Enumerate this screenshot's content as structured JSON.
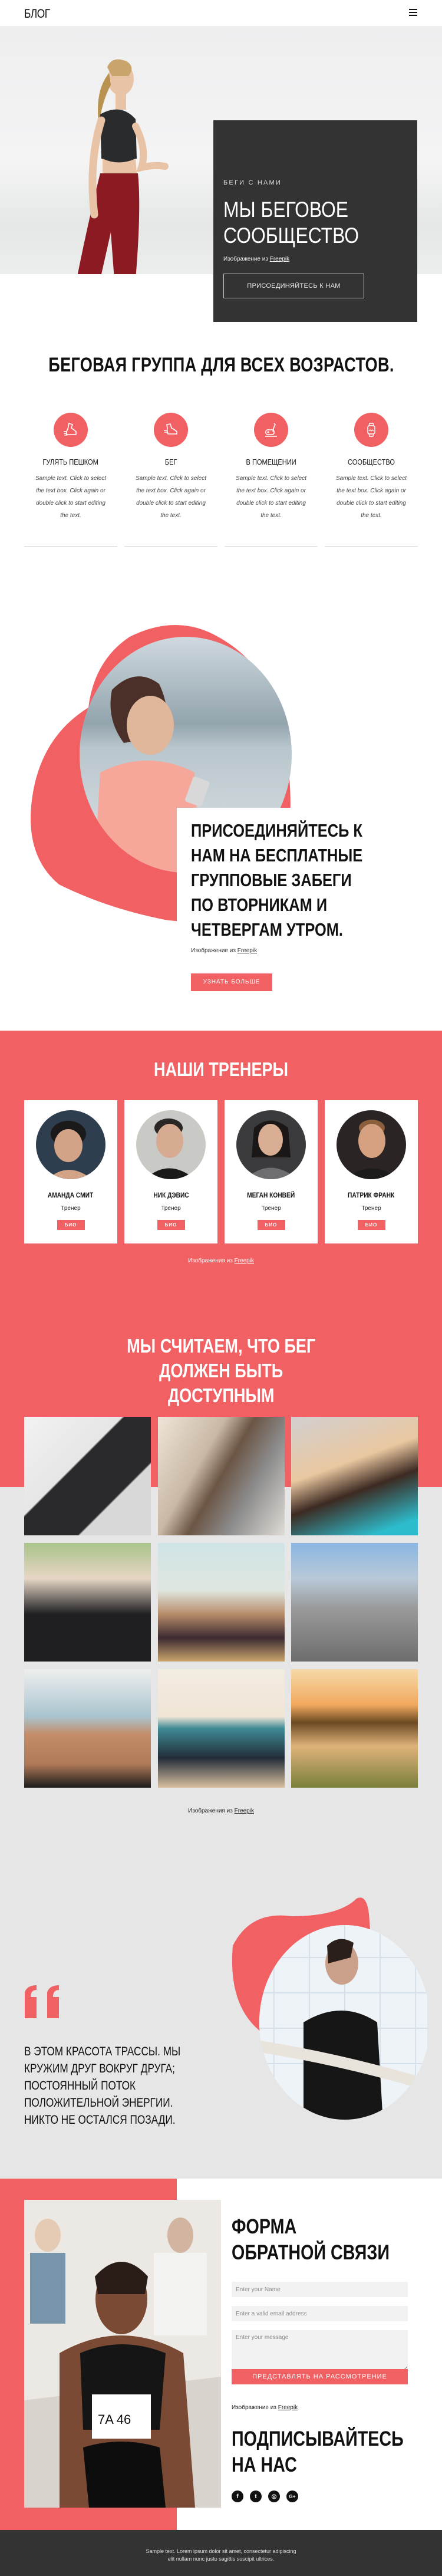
{
  "header": {
    "logo": "БЛОГ",
    "menu_icon": "hamburger-icon"
  },
  "hero": {
    "kicker": "БЕГИ С НАМИ",
    "title_line1": "МЫ БЕГОВОЕ",
    "title_line2": "СООБЩЕСТВО",
    "credit_prefix": "Изображение из",
    "credit_link": "Freepik",
    "button": "ПРИСОЕДИНЯЙТЕСЬ К НАМ"
  },
  "features": {
    "title": "БЕГОВАЯ ГРУППА ДЛЯ ВСЕХ ВОЗРАСТОВ.",
    "items": [
      {
        "icon": "walking-shoe-icon",
        "title": "ГУЛЯТЬ ПЕШКОМ",
        "text": "Sample text. Click to select the text box. Click again or double click to start editing the text."
      },
      {
        "icon": "running-shoe-icon",
        "title": "БЕГ",
        "text": "Sample text. Click to select the text box. Click again or double click to start editing the text."
      },
      {
        "icon": "exercise-bike-icon",
        "title": "В ПОМЕЩЕНИИ",
        "text": "Sample text. Click to select the text box. Click again or double click to start editing the text."
      },
      {
        "icon": "smartwatch-icon",
        "title": "СООБЩЕСТВО",
        "text": "Sample text. Click to select the text box. Click again or double click to start editing the text."
      }
    ]
  },
  "join": {
    "title_lines": [
      "ПРИСОЕДИНЯЙТЕСЬ К",
      "НАМ НА БЕСПЛАТНЫЕ",
      "ГРУППОВЫЕ ЗАБЕГИ",
      "ПО ВТОРНИКАМ И",
      "ЧЕТВЕРГАМ УТРОМ."
    ],
    "credit_prefix": "Изображение из",
    "credit_link": "Freepik",
    "button": "УЗНАТЬ БОЛЬШЕ"
  },
  "trainers": {
    "title": "НАШИ ТРЕНЕРЫ",
    "items": [
      {
        "name": "АМАНДА СМИТ",
        "role": "Тренер",
        "button": "БИО"
      },
      {
        "name": "НИК ДЭВИС",
        "role": "Тренер",
        "button": "БИО"
      },
      {
        "name": "МЕГАН КОНВЕЙ",
        "role": "Тренер",
        "button": "БИО"
      },
      {
        "name": "ПАТРИК ФРАНК",
        "role": "Тренер",
        "button": "БИО"
      }
    ],
    "credit_prefix": "Изображения из",
    "credit_link": "Freepik"
  },
  "gallery": {
    "title_lines": [
      "МЫ СЧИТАЕМ, ЧТО БЕГ",
      "ДОЛЖЕН БЫТЬ",
      "ДОСТУПНЫМ"
    ],
    "images": [
      "couple-jogging-photo",
      "man-drinking-water-photo",
      "woman-drinking-water-photo",
      "group-hands-together-photo",
      "woman-running-photo",
      "man-start-position-photo",
      "shirtless-man-photo",
      "two-women-beach-run-photo",
      "man-sunset-run-photo"
    ],
    "credit_prefix": "Изображения из",
    "credit_link": "Freepik"
  },
  "quote": {
    "lines": [
      "В ЭТОМ КРАСОТА ТРАССЫ. МЫ",
      "КРУЖИМ ДРУГ ВОКРУГ ДРУГА;",
      "ПОСТОЯННЫЙ ПОТОК",
      "ПОЛОЖИТЕЛЬНОЙ ЭНЕРГИИ.",
      "НИКТО НЕ ОСТАЛСЯ ПОЗАДИ."
    ]
  },
  "form": {
    "title_lines": [
      "ФОРМА",
      "ОБРАТНОЙ СВЯЗИ"
    ],
    "name_placeholder": "Enter your Name",
    "email_placeholder": "Enter a valid email address",
    "message_placeholder": "Enter your message",
    "submit": "ПРЕДСТАВЛЯТЬ НА РАССМОТРЕНИЕ",
    "credit_prefix": "Изображение из",
    "credit_link": "Freepik",
    "bib_number": "7A 46"
  },
  "follow": {
    "title_lines": [
      "ПОДПИСЫВАЙТЕСЬ",
      "НА НАС"
    ],
    "socials": [
      {
        "icon": "facebook-icon",
        "glyph": "f"
      },
      {
        "icon": "twitter-icon",
        "glyph": "t"
      },
      {
        "icon": "instagram-icon",
        "glyph": "◎"
      },
      {
        "icon": "google-plus-icon",
        "glyph": "G+"
      }
    ]
  },
  "footer": {
    "line1": "Sample text. Lorem ipsum dolor sit amet, consectetur adipiscing",
    "line2": "elit nullam nunc justo sagittis suscipit ultrices."
  },
  "colors": {
    "accent": "#f16163",
    "dark": "#333333",
    "grey_bg": "#e6e6e6"
  }
}
